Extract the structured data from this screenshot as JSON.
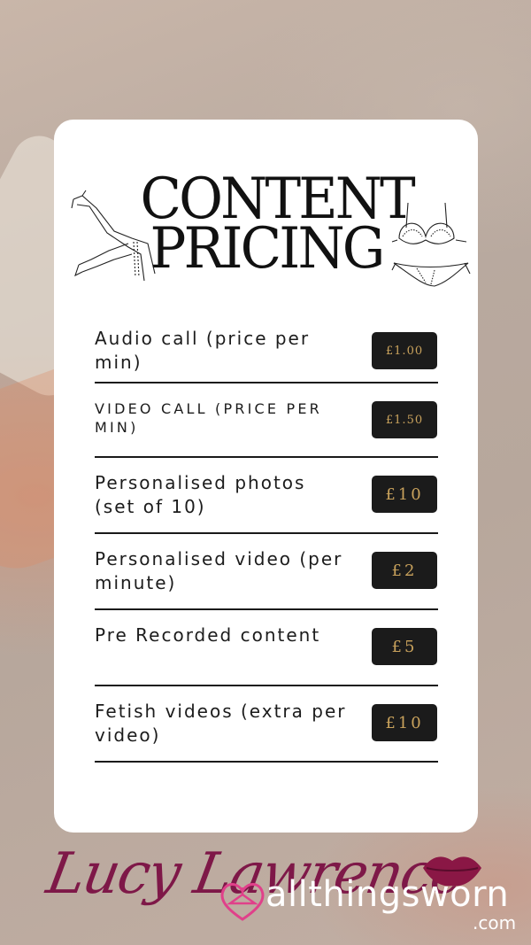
{
  "title": {
    "line1": "CONTENT",
    "line2": "PRICING"
  },
  "rows": [
    {
      "label": "Audio call (price per min)",
      "price": "£1.00"
    },
    {
      "label": "VIDEO CALL (PRICE PER MIN)",
      "price": "£1.50"
    },
    {
      "label": "Personalised photos (set of 10)",
      "price": "£10"
    },
    {
      "label": "Personalised video (per minute)",
      "price": "£2"
    },
    {
      "label": "Pre Recorded content",
      "price": "£5"
    },
    {
      "label": "Fetish videos (extra per video)",
      "price": "£10"
    }
  ],
  "branding": {
    "name": "Lucy Lawrence",
    "site": "allthingsworn",
    "tld": ".com"
  },
  "colors": {
    "price_bg": "#1b1b1b",
    "price_text": "#c9a25c",
    "brand_script": "#7e1848",
    "heart": "#e0408a"
  },
  "icons": {
    "left": "legs-heels-icon",
    "right": "bra-panties-icon",
    "heart": "heart-hanger-icon",
    "lips": "lips-icon"
  }
}
